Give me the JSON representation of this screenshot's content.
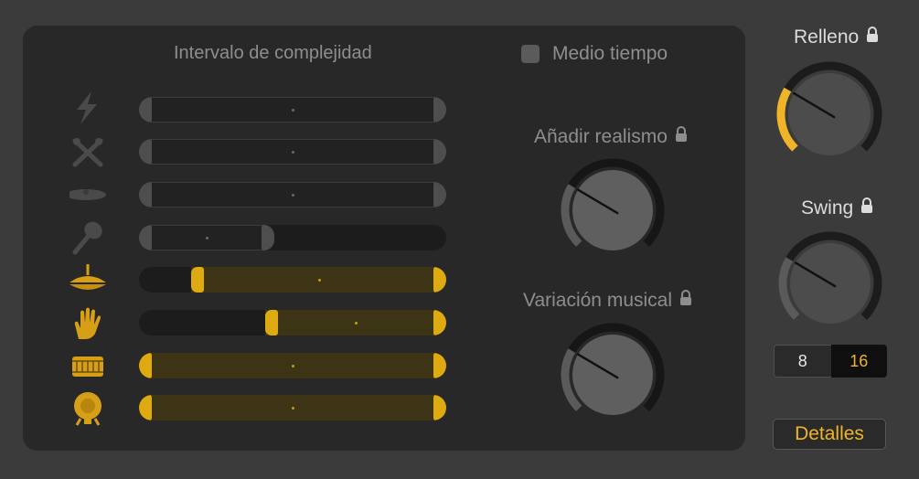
{
  "panel": {
    "title": "Intervalo de complejidad",
    "half_time": {
      "label": "Medio tiempo",
      "checked": false
    }
  },
  "rows": [
    {
      "icon": "lightning-icon",
      "active": false,
      "range": [
        0.0,
        1.0
      ]
    },
    {
      "icon": "crossed-sticks-icon",
      "active": false,
      "range": [
        0.0,
        1.0
      ]
    },
    {
      "icon": "cymbal-icon",
      "active": false,
      "range": [
        0.0,
        1.0
      ]
    },
    {
      "icon": "shaker-icon",
      "active": false,
      "range": [
        0.0,
        0.44
      ]
    },
    {
      "icon": "hihat-icon",
      "active": true,
      "range": [
        0.17,
        1.0
      ]
    },
    {
      "icon": "hand-clap-icon",
      "active": true,
      "range": [
        0.41,
        1.0
      ]
    },
    {
      "icon": "snare-drum-icon",
      "active": true,
      "range": [
        0.0,
        1.0
      ]
    },
    {
      "icon": "kick-drum-icon",
      "active": true,
      "range": [
        0.0,
        1.0
      ]
    }
  ],
  "knobs": {
    "realism": {
      "label": "Añadir realismo",
      "value": 0.28
    },
    "variation": {
      "label": "Variación musical",
      "value": 0.28
    },
    "fill": {
      "label": "Relleno",
      "value": 0.28
    },
    "swing": {
      "label": "Swing",
      "value": 0.28
    }
  },
  "swing_resolution": {
    "options": [
      "8",
      "16"
    ],
    "selected": "16"
  },
  "details_button": {
    "label": "Detalles"
  },
  "colors": {
    "accent": "#f0b429",
    "panel": "#282828",
    "background": "#3b3b3b"
  }
}
